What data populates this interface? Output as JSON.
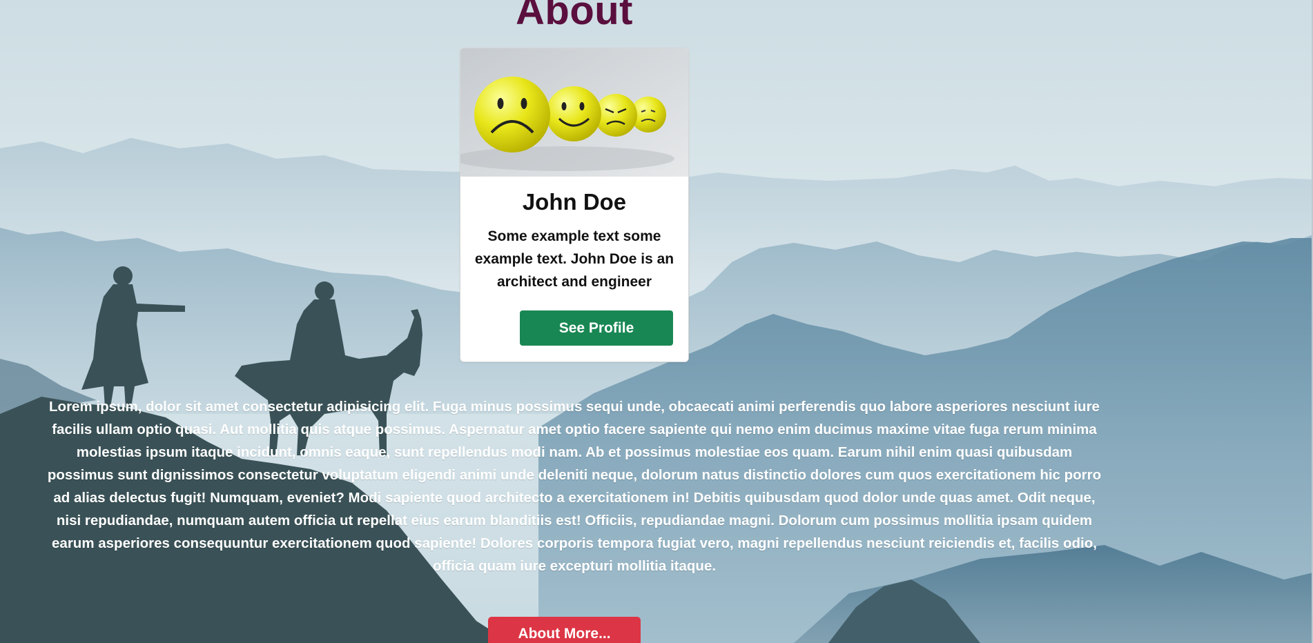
{
  "page": {
    "title": "About"
  },
  "card": {
    "name": "John Doe",
    "text": "Some example text some example text. John Doe is an architect and engineer",
    "button_label": "See Profile",
    "image_icon": "emoji-balls-image"
  },
  "about": {
    "text": "Lorem ipsum, dolor sit amet consectetur adipisicing elit. Fuga minus possimus sequi unde, obcaecati animi perferendis quo labore asperiores nesciunt iure facilis ullam optio quasi. Aut mollitia quis atque possimus. Aspernatur amet optio facere sapiente qui nemo enim ducimus maxime vitae fuga rerum minima molestias ipsum itaque incidunt, omnis eaque, sunt repellendus modi nam. Ab et possimus molestiae eos quam. Earum nihil enim quasi quibusdam possimus sunt dignissimos consectetur voluptatum eligendi animi unde deleniti neque, dolorum natus distinctio dolores cum quos exercitationem hic porro ad alias delectus fugit! Numquam, eveniet? Modi sapiente quod architecto a exercitationem in! Debitis quibusdam quod dolor unde quas amet. Odit neque, nisi repudiandae, numquam autem officia ut repellat eius earum blanditiis est! Officiis, repudiandae magni. Dolorum cum possimus mollitia ipsam quidem earum asperiores consequuntur exercitationem quod sapiente! Dolores corporis tempora fugiat vero, magni repellendus nesciunt reiciendis et, facilis odio, officia quam iure excepturi mollitia itaque.",
    "button_label": "About More..."
  },
  "colors": {
    "title": "#5a0f3e",
    "profile_button": "#198754",
    "about_button": "#dc3545",
    "sky": "#dbe6ea",
    "mountains": "#6f93a8",
    "silhouette": "#3a5257"
  }
}
